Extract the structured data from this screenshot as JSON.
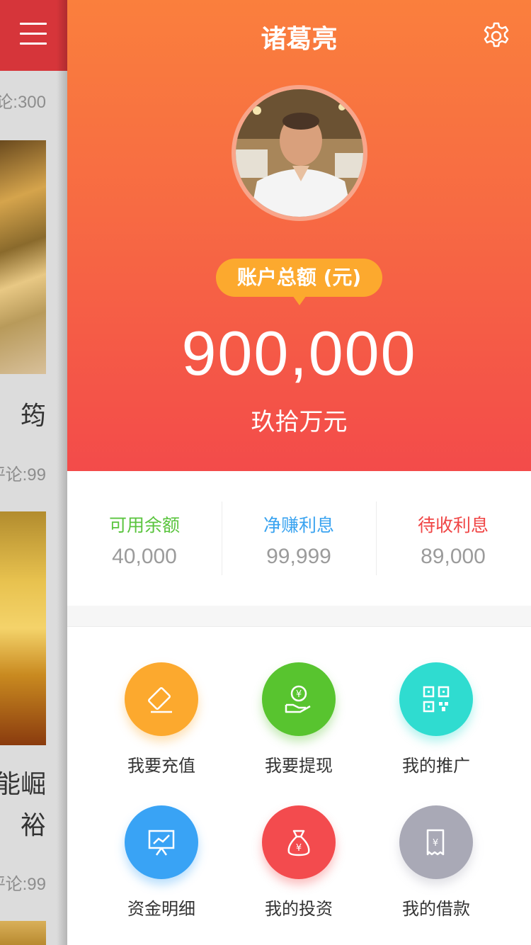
{
  "feed": {
    "meta1": "论:300",
    "title1": "筠",
    "meta2": "评论:99",
    "title2a": "能崛",
    "title2b": "裕",
    "meta3": "评论:99"
  },
  "profile": {
    "name": "诸葛亮",
    "balance_label": "账户总额 (元)",
    "balance": "900,000",
    "balance_cn": "玖拾万元"
  },
  "stats": [
    {
      "label": "可用余额",
      "value": "40,000",
      "color": "#5ac43e"
    },
    {
      "label": "净赚利息",
      "value": "99,999",
      "color": "#39a3f0"
    },
    {
      "label": "待收利息",
      "value": "89,000",
      "color": "#f04545"
    }
  ],
  "actions": [
    {
      "label": "我要充值",
      "icon": "recharge-icon",
      "color": "#fca92e"
    },
    {
      "label": "我要提现",
      "icon": "withdraw-icon",
      "color": "#58c42f"
    },
    {
      "label": "我的推广",
      "icon": "qrcode-icon",
      "color": "#2fdcd0"
    },
    {
      "label": "资金明细",
      "icon": "chart-icon",
      "color": "#39a3f5"
    },
    {
      "label": "我的投资",
      "icon": "money-bag-icon",
      "color": "#f34b4e"
    },
    {
      "label": "我的借款",
      "icon": "receipt-icon",
      "color": "#a9a9b6"
    }
  ]
}
